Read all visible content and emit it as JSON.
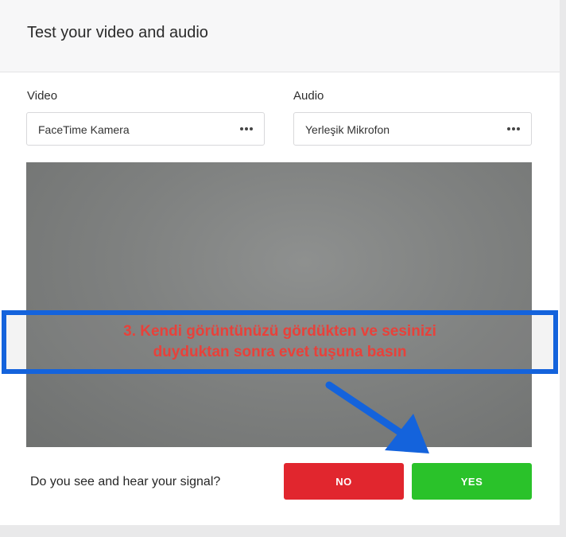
{
  "header": {
    "title": "Test your video and audio"
  },
  "video": {
    "label": "Video",
    "selected": "FaceTime Kamera",
    "more_icon": "ellipsis-icon"
  },
  "audio": {
    "label": "Audio",
    "selected": "Yerleşik Mikrofon",
    "more_icon": "ellipsis-icon"
  },
  "footer": {
    "question": "Do you see and hear your signal?",
    "no_label": "NO",
    "yes_label": "YES"
  },
  "annotation": {
    "line1": "3. Kendi görüntünüzü gördükten ve sesinizi",
    "line2": "duyduktan sonra evet tuşuna basın"
  },
  "colors": {
    "no": "#e1262e",
    "yes": "#2ac22a",
    "annotation_border": "#1463dc",
    "annotation_text": "#e8413a"
  }
}
